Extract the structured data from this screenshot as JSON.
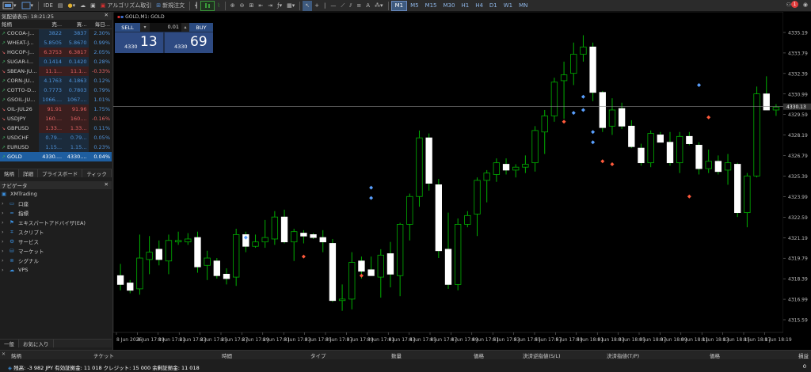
{
  "toolbar": {
    "algo_label": "アルゴリズム取引",
    "new_order_label": "新規注文",
    "timeframes": [
      "M1",
      "M5",
      "M15",
      "M30",
      "H1",
      "H4",
      "D1",
      "W1",
      "MN"
    ],
    "active_tf": "M1",
    "notif_count": "1"
  },
  "marketwatch": {
    "title": "気配値表示: 18:21:25",
    "col_symbol": "銘柄",
    "col_bid": "売...",
    "col_ask": "買...",
    "col_change": "毎日...",
    "rows": [
      {
        "symbol": "COCOA-J...",
        "bid": "3822",
        "ask": "3837",
        "change": "2.30%",
        "dir": "up"
      },
      {
        "symbol": "WHEAT-J...",
        "bid": "5.8505",
        "ask": "5.8670",
        "change": "0.99%",
        "dir": "up"
      },
      {
        "symbol": "HGCOP-J...",
        "bid": "6.3753",
        "ask": "6.3817",
        "change": "2.05%",
        "dir": "dn"
      },
      {
        "symbol": "SUGAR-I...",
        "bid": "0.1414",
        "ask": "0.1420",
        "change": "0.28%",
        "dir": "up"
      },
      {
        "symbol": "SBEAN-JU...",
        "bid": "11.1...",
        "ask": "11.1...",
        "change": "-0.33%",
        "dir": "dn"
      },
      {
        "symbol": "CORN-JU...",
        "bid": "4.1763",
        "ask": "4.1863",
        "change": "0.12%",
        "dir": "up"
      },
      {
        "symbol": "COTTO-D...",
        "bid": "0.7773",
        "ask": "0.7803",
        "change": "0.79%",
        "dir": "up"
      },
      {
        "symbol": "GSOIL-JU...",
        "bid": "1066....",
        "ask": "1067....",
        "change": "1.01%",
        "dir": "up"
      },
      {
        "symbol": "OIL-JUL26",
        "bid": "91.91",
        "ask": "91.96",
        "change": "1.75%",
        "dir": "dn"
      },
      {
        "symbol": "USDJPY",
        "bid": "160....",
        "ask": "160....",
        "change": "-0.16%",
        "dir": "dn"
      },
      {
        "symbol": "GBPUSD",
        "bid": "1.33...",
        "ask": "1.33...",
        "change": "0.11%",
        "dir": "dn"
      },
      {
        "symbol": "USDCHF",
        "bid": "0.79...",
        "ask": "0.79...",
        "change": "0.05%",
        "dir": "up"
      },
      {
        "symbol": "EURUSD",
        "bid": "1.15...",
        "ask": "1.15...",
        "change": "0.23%",
        "dir": "up"
      },
      {
        "symbol": "GOLD",
        "bid": "4330....",
        "ask": "4330....",
        "change": "0.04%",
        "dir": "up"
      }
    ],
    "tabs": [
      "銘柄",
      "詳細",
      "プライスボード",
      "ティック"
    ]
  },
  "navigator": {
    "title": "ナビゲータ",
    "root": "XMTrading",
    "items": [
      "口座",
      "指標",
      "エキスパートアドバイザ(EA)",
      "スクリプト",
      "サービス",
      "マーケット",
      "シグナル",
      "VPS"
    ],
    "tabs": [
      "一般",
      "お気に入り"
    ]
  },
  "chart": {
    "title": "GOLD,M1:  GOLD",
    "oneclick": {
      "sell_label": "SELL",
      "buy_label": "BUY",
      "lot": "0.01",
      "sell_big": "4330",
      "sell_pips": "13",
      "buy_big": "4330",
      "buy_pips": "69"
    },
    "current_price": "4330.13",
    "y_ticks": [
      "4335.19",
      "4333.79",
      "4332.39",
      "4330.99",
      "4329.59",
      "4328.19",
      "4326.79",
      "4325.39",
      "4323.99",
      "4322.59",
      "4321.19",
      "4319.79",
      "4318.39",
      "4316.99",
      "4315.59"
    ],
    "x_ticks": [
      "8 Jun 2026",
      "8 Jun 17:19",
      "8 Jun 17:21",
      "8 Jun 17:23",
      "8 Jun 17:25",
      "8 Jun 17:27",
      "8 Jun 17:29",
      "8 Jun 17:31",
      "8 Jun 17:33",
      "8 Jun 17:35",
      "8 Jun 17:37",
      "8 Jun 17:39",
      "8 Jun 17:41",
      "8 Jun 17:43",
      "8 Jun 17:45",
      "8 Jun 17:47",
      "8 Jun 17:49",
      "8 Jun 17:51",
      "8 Jun 17:53",
      "8 Jun 17:55",
      "8 Jun 17:57",
      "8 Jun 17:59",
      "8 Jun 18:01",
      "8 Jun 18:03",
      "8 Jun 18:05",
      "8 Jun 18:07",
      "8 Jun 18:09",
      "8 Jun 18:11",
      "8 Jun 18:13",
      "8 Jun 18:15",
      "8 Jun 18:17",
      "8 Jun 18:19"
    ],
    "candles": [
      [
        4318.6,
        4319.4,
        4317.6,
        4318.0
      ],
      [
        4318.1,
        4318.3,
        4317.4,
        4317.6
      ],
      [
        4317.7,
        4321.4,
        4317.3,
        4319.8
      ],
      [
        4319.7,
        4321.3,
        4318.7,
        4320.2
      ],
      [
        4320.4,
        4321.0,
        4319.3,
        4319.7
      ],
      [
        4319.6,
        4321.4,
        4318.7,
        4321.0
      ],
      [
        4320.9,
        4321.6,
        4320.7,
        4321.0
      ],
      [
        4320.9,
        4321.5,
        4320.7,
        4321.1
      ],
      [
        4321.2,
        4321.6,
        4318.8,
        4319.2
      ],
      [
        4319.3,
        4320.3,
        4318.3,
        4319.8
      ],
      [
        4319.6,
        4319.8,
        4318.4,
        4318.6
      ],
      [
        4318.7,
        4319.1,
        4318.0,
        4318.4
      ],
      [
        4318.5,
        4321.8,
        4317.9,
        4321.4
      ],
      [
        4321.4,
        4321.6,
        4320.2,
        4320.6
      ],
      [
        4320.6,
        4321.4,
        4320.5,
        4320.9
      ],
      [
        4320.9,
        4322.4,
        4320.5,
        4321.2
      ],
      [
        4321.1,
        4323.0,
        4320.7,
        4322.6
      ],
      [
        4322.6,
        4323.1,
        4320.8,
        4320.9
      ],
      [
        4320.9,
        4321.8,
        4319.6,
        4321.6
      ],
      [
        4321.5,
        4321.7,
        4320.8,
        4321.3
      ],
      [
        4321.4,
        4321.5,
        4321.1,
        4321.2
      ],
      [
        4321.2,
        4321.7,
        4320.2,
        4320.9
      ],
      [
        4320.8,
        4321.1,
        4316.8,
        4316.9
      ],
      [
        4316.9,
        4318.0,
        4316.2,
        4317.0
      ],
      [
        4317.0,
        4320.2,
        4316.3,
        4319.5
      ],
      [
        4319.6,
        4319.9,
        4318.4,
        4318.9
      ],
      [
        4319.0,
        4319.9,
        4318.6,
        4318.6
      ],
      [
        4318.5,
        4320.4,
        4317.1,
        4320.0
      ],
      [
        4320.1,
        4320.9,
        4317.8,
        4318.7
      ],
      [
        4318.6,
        4322.2,
        4317.2,
        4322.1
      ],
      [
        4322.1,
        4324.2,
        4321.0,
        4324.0
      ],
      [
        4324.0,
        4328.5,
        4323.3,
        4328.0
      ],
      [
        4328.0,
        4328.3,
        4324.4,
        4324.9
      ],
      [
        4324.8,
        4325.2,
        4319.8,
        4320.3
      ],
      [
        4320.4,
        4322.9,
        4317.7,
        4318.0
      ],
      [
        4318.0,
        4322.5,
        4317.6,
        4322.1
      ],
      [
        4322.1,
        4323.0,
        4321.9,
        4322.7
      ],
      [
        4322.8,
        4325.3,
        4321.3,
        4325.1
      ],
      [
        4325.1,
        4325.8,
        4323.6,
        4325.6
      ],
      [
        4325.5,
        4326.6,
        4325.0,
        4326.3
      ],
      [
        4326.2,
        4326.6,
        4325.5,
        4325.8
      ],
      [
        4325.8,
        4326.2,
        4325.3,
        4326.0
      ],
      [
        4326.0,
        4326.8,
        4325.6,
        4326.2
      ],
      [
        4326.3,
        4328.8,
        4325.7,
        4328.5
      ],
      [
        4328.4,
        4329.9,
        4326.9,
        4329.5
      ],
      [
        4329.5,
        4332.1,
        4329.1,
        4331.8
      ],
      [
        4331.9,
        4333.2,
        4329.3,
        4332.3
      ],
      [
        4332.4,
        4334.5,
        4331.6,
        4333.7
      ],
      [
        4333.7,
        4335.0,
        4333.2,
        4334.2
      ],
      [
        4334.2,
        4334.5,
        4330.5,
        4331.1
      ],
      [
        4331.1,
        4331.2,
        4328.4,
        4328.7
      ],
      [
        4328.8,
        4330.7,
        4328.2,
        4329.9
      ],
      [
        4330.0,
        4330.4,
        4328.6,
        4328.8
      ],
      [
        4328.8,
        4329.2,
        4327.3,
        4327.4
      ],
      [
        4327.3,
        4327.6,
        4326.1,
        4326.3
      ],
      [
        4326.3,
        4328.5,
        4326.0,
        4328.3
      ],
      [
        4328.2,
        4328.4,
        4327.7,
        4327.7
      ],
      [
        4327.7,
        4328.4,
        4326.1,
        4326.3
      ],
      [
        4326.3,
        4328.4,
        4325.6,
        4328.1
      ],
      [
        4328.1,
        4328.4,
        4327.5,
        4327.6
      ],
      [
        4327.5,
        4327.7,
        4325.5,
        4325.9
      ],
      [
        4325.9,
        4327.2,
        4325.6,
        4326.4
      ],
      [
        4326.4,
        4326.8,
        4325.5,
        4325.7
      ],
      [
        4325.8,
        4326.9,
        4324.8,
        4326.3
      ],
      [
        4326.2,
        4326.3,
        4322.6,
        4322.9
      ],
      [
        4322.9,
        4325.6,
        4321.9,
        4325.4
      ],
      [
        4325.4,
        4331.5,
        4325.3,
        4331.0
      ],
      [
        4331.0,
        4332.2,
        4329.9,
        4329.9
      ],
      [
        4329.9,
        4330.3,
        4329.5,
        4330.1
      ]
    ],
    "markers": [
      [
        13,
        4321.2,
        "b"
      ],
      [
        19,
        4319.9,
        "s"
      ],
      [
        25,
        4318.6,
        "s"
      ],
      [
        26,
        4324.6,
        "b"
      ],
      [
        26,
        4323.9,
        "b"
      ],
      [
        46,
        4329.1,
        "s"
      ],
      [
        47,
        4329.7,
        "b"
      ],
      [
        48,
        4330.8,
        "b"
      ],
      [
        48,
        4329.9,
        "b"
      ],
      [
        49,
        4328.4,
        "b"
      ],
      [
        49,
        4327.7,
        "b"
      ],
      [
        50,
        4326.4,
        "s"
      ],
      [
        51,
        4326.2,
        "s"
      ],
      [
        59,
        4324.0,
        "s"
      ],
      [
        60,
        4331.6,
        "b"
      ],
      [
        61,
        4329.4,
        "s"
      ]
    ]
  },
  "bottom": {
    "cols": [
      "銘柄",
      "チケット",
      "時間",
      "タイプ",
      "数量",
      "価格",
      "決済逆指値(S/L)",
      "決済指値(T/P)",
      "価格",
      "損益"
    ],
    "status": "残高: -3 982 JPY  有効証拠金: 11 018  クレジット: 15 000  余剰証拠金: 11 018",
    "pl": "0"
  }
}
